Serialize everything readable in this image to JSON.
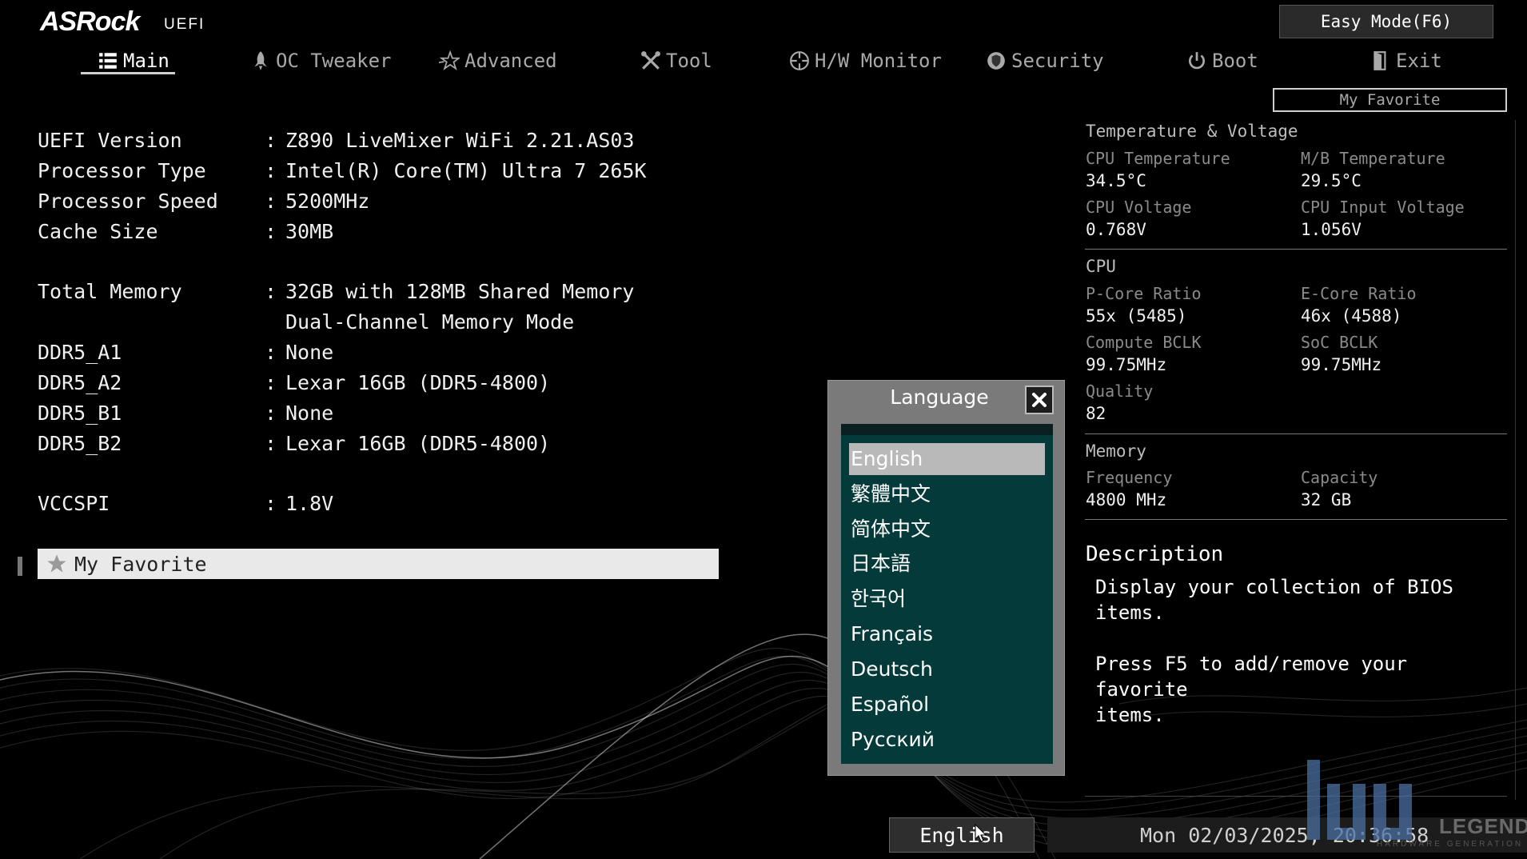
{
  "header": {
    "logo": "ASRock",
    "logo_sub": "UEFI",
    "easy_mode": "Easy Mode(F6)",
    "my_favorite_btn": "My Favorite"
  },
  "tabs": [
    {
      "label": "Main",
      "icon": "list-icon",
      "active": true
    },
    {
      "label": "OC Tweaker",
      "icon": "rocket-icon"
    },
    {
      "label": "Advanced",
      "icon": "star-icon"
    },
    {
      "label": "Tool",
      "icon": "tools-icon"
    },
    {
      "label": "H/W Monitor",
      "icon": "crosshair-icon"
    },
    {
      "label": "Security",
      "icon": "shield-icon"
    },
    {
      "label": "Boot",
      "icon": "power-icon"
    },
    {
      "label": "Exit",
      "icon": "exit-door-icon"
    }
  ],
  "main": {
    "rows": [
      {
        "label": "UEFI Version",
        "value": "Z890 LiveMixer WiFi 2.21.AS03"
      },
      {
        "label": "Processor Type",
        "value": "Intel(R) Core(TM) Ultra 7 265K"
      },
      {
        "label": "Processor Speed",
        "value": "5200MHz"
      },
      {
        "label": "Cache Size",
        "value": "30MB"
      },
      {
        "label": "Total Memory",
        "value": "32GB with 128MB Shared Memory"
      },
      {
        "label": "",
        "value": "Dual-Channel Memory Mode"
      },
      {
        "label": "DDR5_A1",
        "value": "None"
      },
      {
        "label": "DDR5_A2",
        "value": "Lexar 16GB (DDR5-4800)"
      },
      {
        "label": "DDR5_B1",
        "value": "None"
      },
      {
        "label": "DDR5_B2",
        "value": "Lexar 16GB (DDR5-4800)"
      },
      {
        "label": "VCCSPI",
        "value": "1.8V"
      }
    ],
    "separator": ":",
    "favorite_label": "My Favorite"
  },
  "right_panel": {
    "temp_section": "Temperature & Voltage",
    "cpu_temp_label": "CPU Temperature",
    "cpu_temp": "34.5°C",
    "mb_temp_label": "M/B Temperature",
    "mb_temp": "29.5°C",
    "cpu_volt_label": "CPU Voltage",
    "cpu_volt": "0.768V",
    "cpu_in_volt_label": "CPU Input Voltage",
    "cpu_in_volt": "1.056V",
    "cpu_section": "CPU",
    "pcore_label": "P-Core Ratio",
    "pcore": "55x (5485)",
    "ecore_label": "E-Core Ratio",
    "ecore": "46x (4588)",
    "bclk_label": "Compute BCLK",
    "bclk": "99.75MHz",
    "soc_label": "SoC BCLK",
    "soc": "99.75MHz",
    "quality_label": "Quality",
    "quality": "82",
    "mem_section": "Memory",
    "freq_label": "Frequency",
    "freq": "4800 MHz",
    "cap_label": "Capacity",
    "cap": "32 GB",
    "desc_title": "Description",
    "desc_text": "Display your collection of BIOS items.\n\nPress F5 to add/remove your favorite\nitems."
  },
  "language_dialog": {
    "title": "Language",
    "options": [
      "English",
      "繁體中文",
      "简体中文",
      "日本語",
      "한국어",
      "Français",
      "Deutsch",
      "Español",
      "Русский"
    ],
    "selected": "English"
  },
  "footer": {
    "language": "English",
    "datetime": "Mon 02/03/2025, 20:36:58"
  },
  "watermark": {
    "text": "LEGEND",
    "sub": "HARDWARE GENERATION"
  }
}
